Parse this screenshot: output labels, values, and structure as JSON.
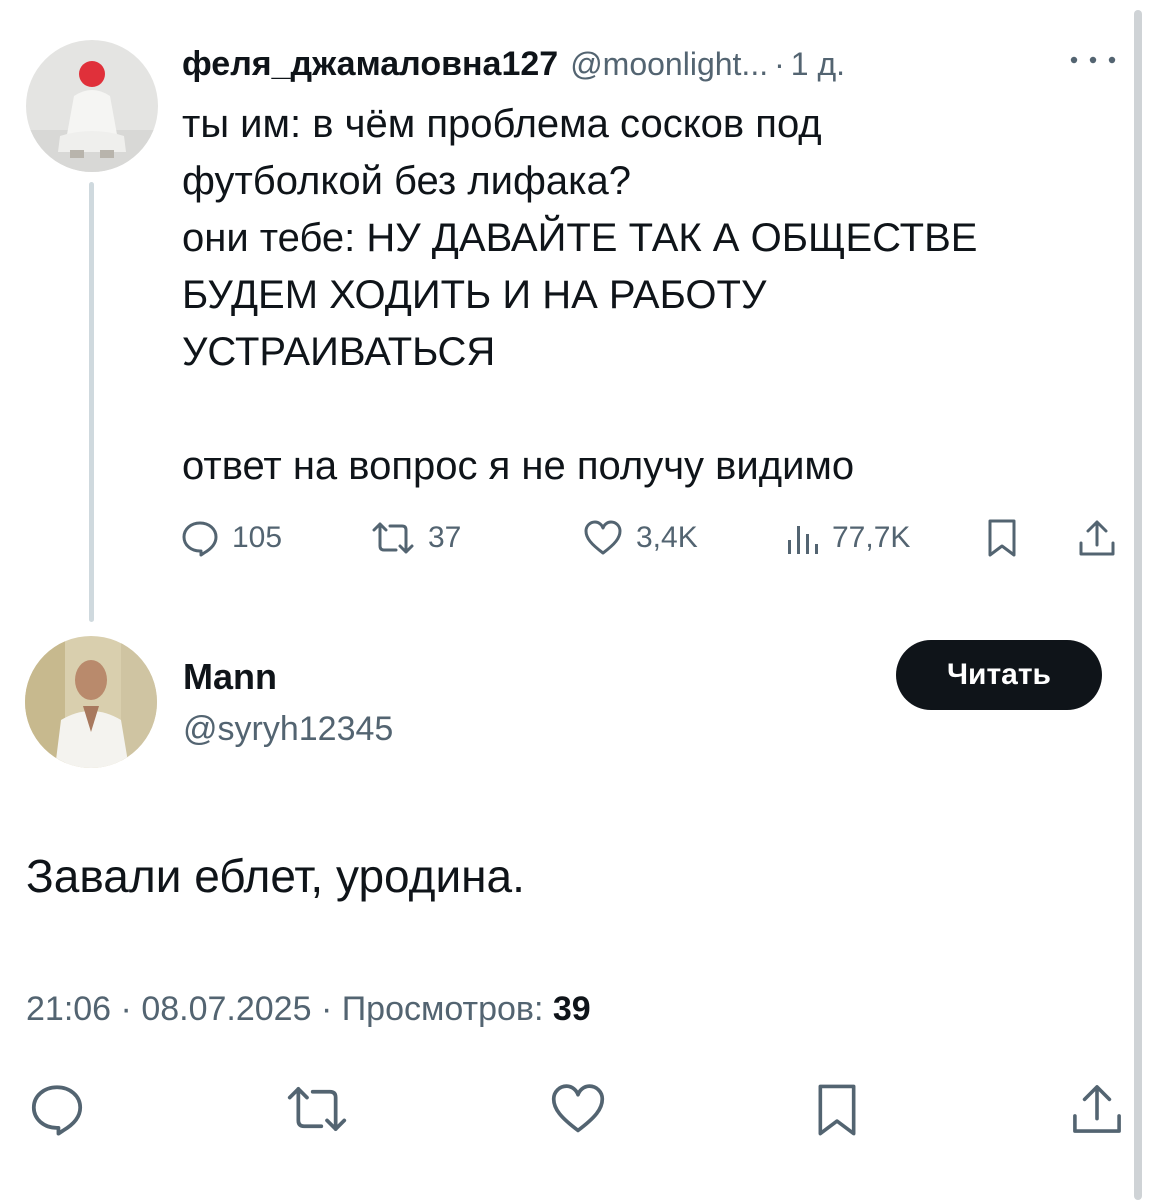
{
  "tweet": {
    "author_name": "феля_джамаловна127",
    "handle": "@moonlight...",
    "separator": "·",
    "time": "1 д.",
    "text_lines": [
      "ты им: в чём проблема сосков под",
      "футболкой без лифака?",
      "они тебе: НУ ДАВАЙТЕ ТАК А ОБЩЕСТВЕ",
      "БУДЕМ ХОДИТЬ И НА РАБОТУ",
      "УСТРАИВАТЬСЯ"
    ],
    "text_after": "ответ на вопрос я не получу видимо",
    "stats": {
      "replies": "105",
      "retweets": "37",
      "likes": "3,4K",
      "views": "77,7K"
    },
    "icons": [
      "reply-icon",
      "retweet-icon",
      "like-icon",
      "views-icon",
      "bookmark-icon",
      "share-icon",
      "more-icon"
    ]
  },
  "reply": {
    "author_name": "Mann",
    "handle": "@syryh12345",
    "follow_label": "Читать",
    "text": "Завали еблет, уродина.",
    "time": "21:06",
    "separator": "·",
    "date": "08.07.2025",
    "views_label": "Просмотров:",
    "views_count": "39",
    "icons": [
      "reply-icon",
      "retweet-icon",
      "like-icon",
      "bookmark-icon",
      "share-icon"
    ]
  },
  "colors": {
    "text": "#0f1419",
    "secondary": "#536471",
    "thread_line": "#cfd9de",
    "button_bg": "#0f1419"
  }
}
